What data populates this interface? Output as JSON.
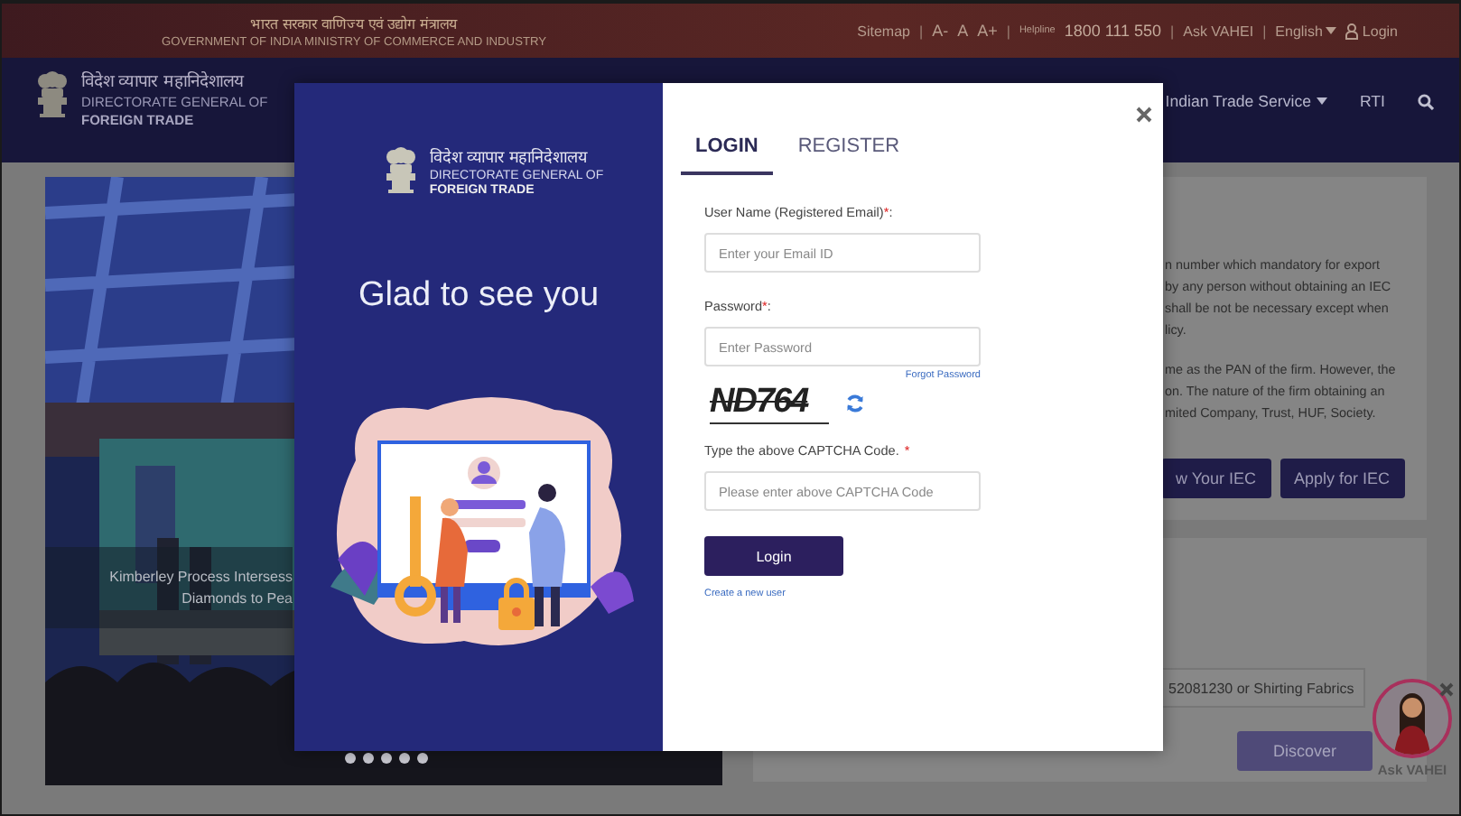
{
  "top_bar": {
    "ministry_hindi": "भारत सरकार  वाणिज्य एवं उद्योग मंत्रालय",
    "ministry_english": "GOVERNMENT OF INDIA  MINISTRY OF COMMERCE AND INDUSTRY",
    "items": [
      {
        "kind": "link",
        "text": "Sitemap"
      },
      {
        "kind": "separator",
        "text": "|"
      },
      {
        "kind": "link",
        "text": "A-"
      },
      {
        "kind": "link",
        "text": "A"
      },
      {
        "kind": "link",
        "text": "A+"
      },
      {
        "kind": "separator",
        "text": "|"
      },
      {
        "kind": "label",
        "text": "Helpline"
      },
      {
        "kind": "phone",
        "text": "1800 111 550"
      },
      {
        "kind": "separator",
        "text": "|"
      },
      {
        "kind": "link",
        "text": "Ask VAHEI"
      },
      {
        "kind": "separator",
        "text": "|"
      },
      {
        "kind": "dropdown",
        "text": "English"
      },
      {
        "kind": "login",
        "text": "Login"
      }
    ]
  },
  "header": {
    "logo": {
      "hindi": "विदेश व्यापार महानिदेशालय",
      "line1": "DIRECTORATE GENERAL OF",
      "line2": "FOREIGN TRADE"
    },
    "nav": [
      {
        "text": "Indian Trade Service",
        "dropdown": true
      },
      {
        "text": "RTI",
        "dropdown": false
      }
    ]
  },
  "carousel": {
    "caption": [
      "Kimberley Process Intersess",
      "Diamonds to Pea"
    ]
  },
  "iec_panel": {
    "paragraphs": [
      [
        "n number which mandatory for export",
        "by any person without obtaining an IEC",
        "shall be not be necessary except when",
        "licy."
      ],
      [
        "me as the PAN of the firm. However, the",
        "on. The nature of the firm obtaining an",
        "mited Company, Trust, HUF, Society."
      ]
    ],
    "buttons": [
      "w Your IEC",
      "Apply for IEC"
    ]
  },
  "search_panel": {
    "placeholder": "52081230 or Shirting Fabrics",
    "button": "Discover"
  },
  "chatbot": {
    "label": "Ask VAHEI"
  },
  "modal": {
    "logo": {
      "hindi": "विदेश व्यापार महानिदेशालय",
      "line1": "DIRECTORATE GENERAL OF",
      "line2": "FOREIGN TRADE"
    },
    "greeting": "Glad to see you",
    "tabs": [
      {
        "label": "LOGIN",
        "selected": true
      },
      {
        "label": "REGISTER",
        "selected": false
      }
    ],
    "fields": [
      {
        "kind": "text",
        "label": "User Name (Registered Email)",
        "mark": "*",
        "suffix": ":",
        "placeholder": "Enter your Email ID"
      },
      {
        "kind": "password",
        "label": "Password",
        "mark": "*",
        "suffix": ":",
        "placeholder": "Enter Password",
        "link": "Forgot Password"
      },
      {
        "kind": "captcha",
        "captcha": "ND764",
        "label": "Type the above CAPTCHA Code.",
        "mark": "*",
        "placeholder": "Please enter above CAPTCHA Code"
      }
    ],
    "submit": "Login",
    "create_link": "Create a new user"
  }
}
